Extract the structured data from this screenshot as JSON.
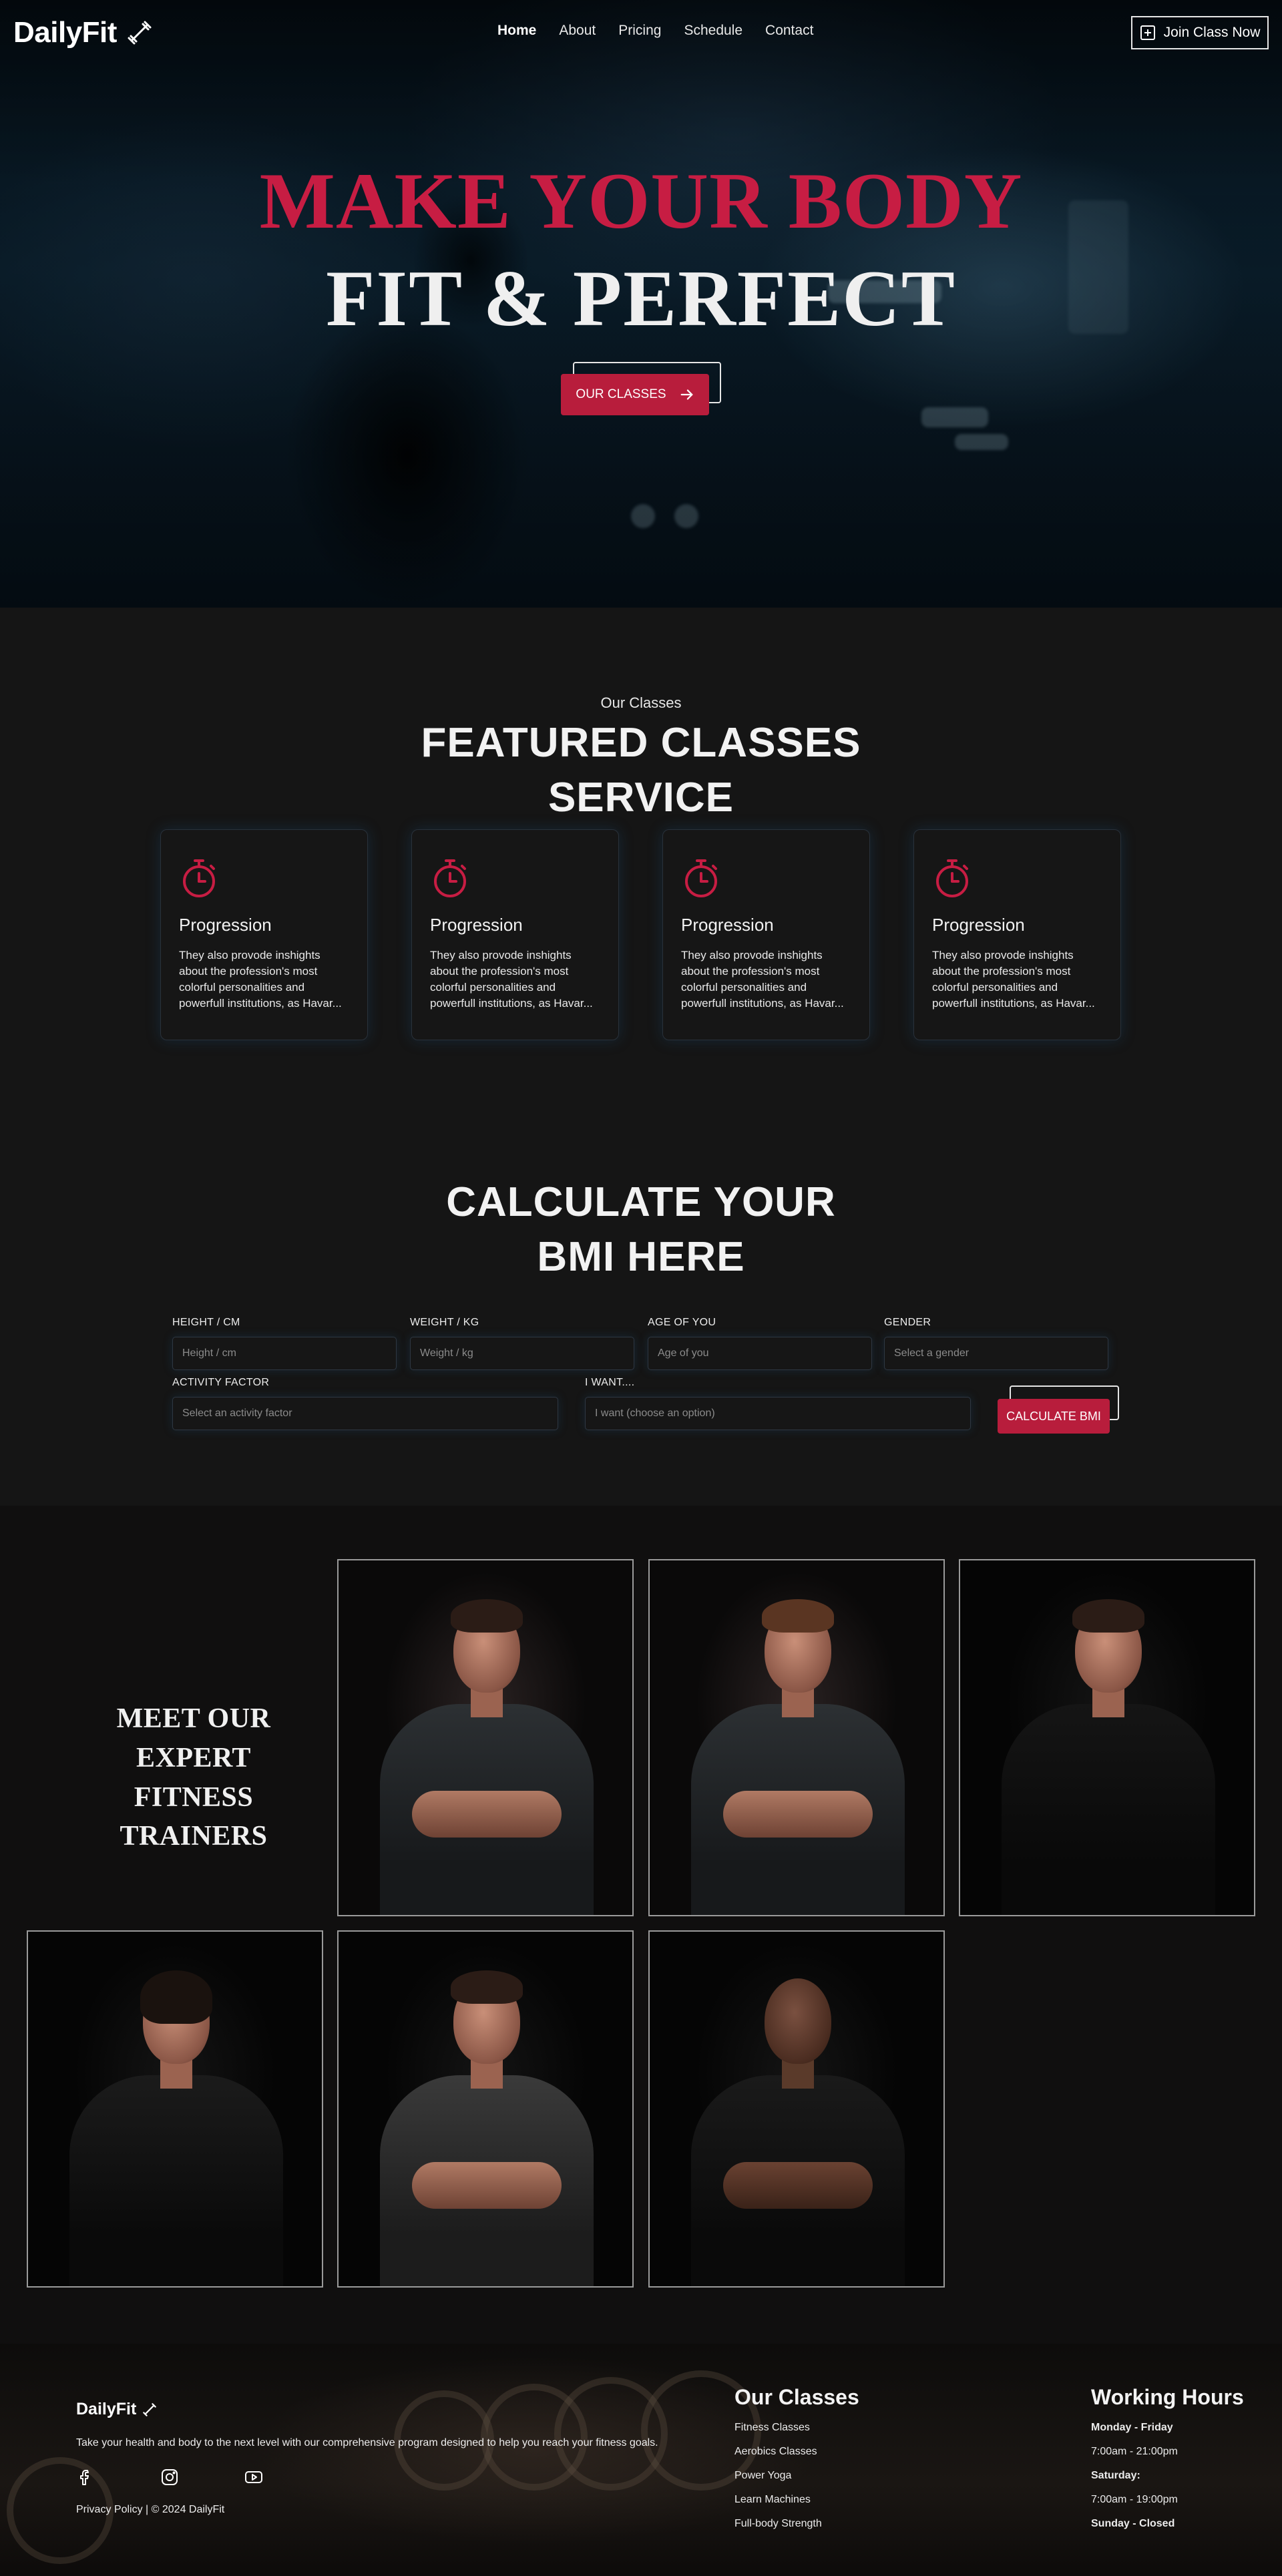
{
  "brand": {
    "name": "DailyFit",
    "logo_icon": "dumbbell-icon"
  },
  "nav": {
    "links": [
      "Home",
      "About",
      "Pricing",
      "Schedule",
      "Contact"
    ],
    "active": "Home",
    "join_label": "Join Class Now",
    "join_icon": "plus-square-icon"
  },
  "hero": {
    "title_line1": "MAKE YOUR BODY",
    "title_line2": "FIT & PERFECT",
    "cta_label": "OUR CLASSES",
    "cta_icon": "arrow-right-icon"
  },
  "classes": {
    "eyebrow": "Our Classes",
    "title_line1": "FEATURED CLASSES",
    "title_line2": "SERVICE",
    "cards": [
      {
        "icon": "stopwatch-icon",
        "title": "Progression",
        "text": "They also provode inshights about the profession's most colorful personalities and powerfull institutions, as Havar..."
      },
      {
        "icon": "stopwatch-icon",
        "title": "Progression",
        "text": "They also provode inshights about the profession's most colorful personalities and powerfull institutions, as Havar..."
      },
      {
        "icon": "stopwatch-icon",
        "title": "Progression",
        "text": "They also provode inshights about the profession's most colorful personalities and powerfull institutions, as Havar..."
      },
      {
        "icon": "stopwatch-icon",
        "title": "Progression",
        "text": "They also provode inshights about the profession's most colorful personalities and powerfull institutions, as Havar..."
      }
    ]
  },
  "bmi": {
    "title_line1": "CALCULATE YOUR",
    "title_line2": "BMI HERE",
    "height": {
      "label": "HEIGHT / CM",
      "placeholder": "Height / cm"
    },
    "weight": {
      "label": "WEIGHT / KG",
      "placeholder": "Weight / kg"
    },
    "age": {
      "label": "AGE OF YOU",
      "placeholder": "Age of you"
    },
    "gender": {
      "label": "GENDER",
      "placeholder": "Select a gender"
    },
    "activity": {
      "label": "ACTIVITY FACTOR",
      "placeholder": "Select an activity factor"
    },
    "want": {
      "label": "I WANT....",
      "placeholder": "I want (choose an option)"
    },
    "submit_label": "CALCULATE BMI"
  },
  "trainers": {
    "title_line1": "MEET OUR EXPERT",
    "title_line2": "FITNESS TRAINERS"
  },
  "footer": {
    "brand": "DailyFit",
    "tagline": "Take your health and body to the next level with our comprehensive program designed to help you reach your fitness goals.",
    "social_icons": [
      "facebook-icon",
      "instagram-icon",
      "youtube-icon"
    ],
    "legal_link": "Privacy Policy",
    "copyright": "| © 2024 DailyFit",
    "classes_title": "Our Classes",
    "classes": [
      "Fitness Classes",
      "Aerobics Classes",
      "Power Yoga",
      "Learn Machines",
      "Full-body Strength"
    ],
    "hours_title": "Working Hours",
    "hours": [
      "Monday - Friday",
      "7:00am - 21:00pm",
      "Saturday:",
      "7:00am - 19:00pm",
      "Sunday - Closed"
    ]
  },
  "colors": {
    "accent": "#b81d3c",
    "hero_title_red": "#c71d43",
    "background": "#141414"
  }
}
